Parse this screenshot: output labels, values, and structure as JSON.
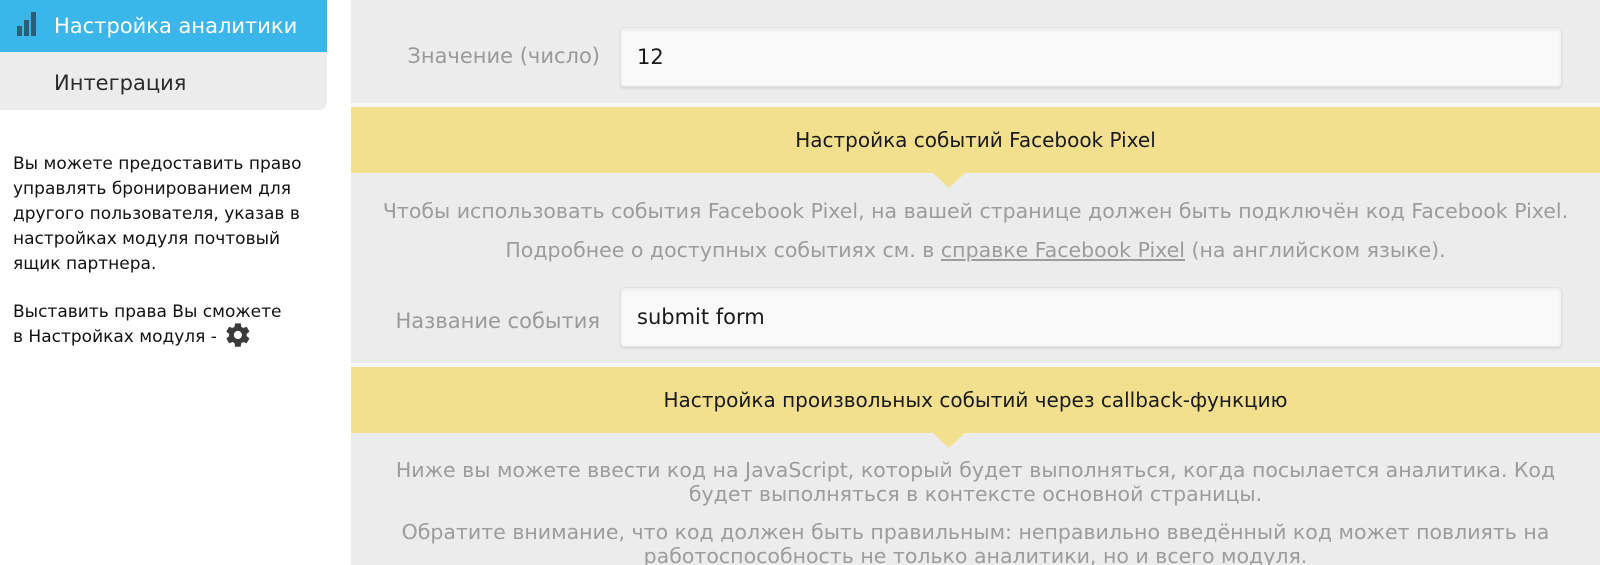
{
  "sidebar": {
    "menu": [
      {
        "label": "Настройка аналитики",
        "icon": "bar-chart-icon",
        "active": true
      },
      {
        "label": "Интеграция",
        "active": false
      }
    ],
    "note_1": "Вы можете предоставить право управлять бронированием для другого пользователя, указав в настройках модуля почтовый ящик партнера.",
    "note_2_lines": [
      "Выставить права Вы сможете",
      "в Настройках модуля -"
    ],
    "note_2_icon": "gear-icon"
  },
  "main": {
    "value_field": {
      "label": "Значение (число)",
      "value": "12"
    },
    "facebook_section": {
      "title": "Настройка событий Facebook Pixel",
      "desc_1": "Чтобы использовать события Facebook Pixel, на вашей странице должен быть подключён код Facebook Pixel.",
      "desc_2_before": "Подробнее о доступных событиях см. в ",
      "desc_2_link": "справке Facebook Pixel",
      "desc_2_after": " (на английском языке).",
      "event_field": {
        "label": "Название события",
        "value": "submit form"
      }
    },
    "callback_section": {
      "title": "Настройка произвольных событий через callback-функцию",
      "desc_1": "Ниже вы можете ввести код на JavaScript, который будет выполняться, когда посылается аналитика. Код будет выполняться в контексте основной страницы.",
      "desc_2": "Обратите внимание, что код должен быть правильным: неправильно введённый код может повлиять на работоспособность не только аналитики, но и всего модуля."
    }
  },
  "colors": {
    "accent": "#3ab6ea",
    "section_bg": "#f2e08f",
    "panel_bg": "#ececec"
  }
}
